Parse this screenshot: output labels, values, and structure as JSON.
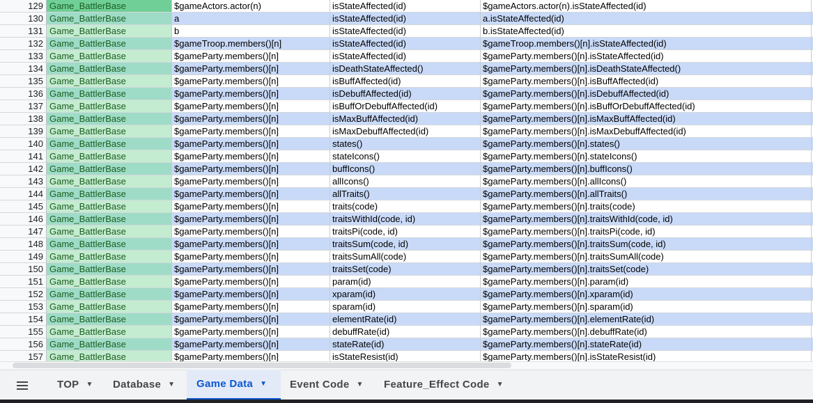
{
  "sheet": {
    "rows": [
      {
        "num": "129",
        "cls": "Game_BattlerBase",
        "obj": "$gameActors.actor(n)",
        "method": "isStateAffected(id)",
        "full": "$gameActors.actor(n).isStateAffected(id)",
        "cls_color": "#6fcf97"
      },
      {
        "num": "130",
        "cls": "Game_BattlerBase",
        "obj": "a",
        "method": "isStateAffected(id)",
        "full": "a.isStateAffected(id)",
        "cls_color": "#9fdcc7"
      },
      {
        "num": "131",
        "cls": "Game_BattlerBase",
        "obj": "b",
        "method": "isStateAffected(id)",
        "full": "b.isStateAffected(id)",
        "cls_color": "#c4ecd0"
      },
      {
        "num": "132",
        "cls": "Game_BattlerBase",
        "obj": "$gameTroop.members()[n]",
        "method": "isStateAffected(id)",
        "full": "$gameTroop.members()[n].isStateAffected(id)",
        "cls_color": "#9fdcc7"
      },
      {
        "num": "133",
        "cls": "Game_BattlerBase",
        "obj": "$gameParty.members()[n]",
        "method": "isStateAffected(id)",
        "full": "$gameParty.members()[n].isStateAffected(id)",
        "cls_color": "#c4ecd0"
      },
      {
        "num": "134",
        "cls": "Game_BattlerBase",
        "obj": "$gameParty.members()[n]",
        "method": "isDeathStateAffected()",
        "full": "$gameParty.members()[n].isDeathStateAffected()",
        "cls_color": "#9fdcc7"
      },
      {
        "num": "135",
        "cls": "Game_BattlerBase",
        "obj": "$gameParty.members()[n]",
        "method": "isBuffAffected(id)",
        "full": "$gameParty.members()[n].isBuffAffected(id)",
        "cls_color": "#c4ecd0"
      },
      {
        "num": "136",
        "cls": "Game_BattlerBase",
        "obj": "$gameParty.members()[n]",
        "method": "isDebuffAffected(id)",
        "full": "$gameParty.members()[n].isDebuffAffected(id)",
        "cls_color": "#9fdcc7"
      },
      {
        "num": "137",
        "cls": "Game_BattlerBase",
        "obj": "$gameParty.members()[n]",
        "method": "isBuffOrDebuffAffected(id)",
        "full": "$gameParty.members()[n].isBuffOrDebuffAffected(id)",
        "cls_color": "#c4ecd0"
      },
      {
        "num": "138",
        "cls": "Game_BattlerBase",
        "obj": "$gameParty.members()[n]",
        "method": "isMaxBuffAffected(id)",
        "full": "$gameParty.members()[n].isMaxBuffAffected(id)",
        "cls_color": "#9fdcc7"
      },
      {
        "num": "139",
        "cls": "Game_BattlerBase",
        "obj": "$gameParty.members()[n]",
        "method": "isMaxDebuffAffected(id)",
        "full": "$gameParty.members()[n].isMaxDebuffAffected(id)",
        "cls_color": "#c4ecd0"
      },
      {
        "num": "140",
        "cls": "Game_BattlerBase",
        "obj": "$gameParty.members()[n]",
        "method": "states()",
        "full": "$gameParty.members()[n].states()",
        "cls_color": "#9fdcc7"
      },
      {
        "num": "141",
        "cls": "Game_BattlerBase",
        "obj": "$gameParty.members()[n]",
        "method": "stateIcons()",
        "full": "$gameParty.members()[n].stateIcons()",
        "cls_color": "#c4ecd0"
      },
      {
        "num": "142",
        "cls": "Game_BattlerBase",
        "obj": "$gameParty.members()[n]",
        "method": "buffIcons()",
        "full": "$gameParty.members()[n].buffIcons()",
        "cls_color": "#9fdcc7"
      },
      {
        "num": "143",
        "cls": "Game_BattlerBase",
        "obj": "$gameParty.members()[n]",
        "method": "allIcons()",
        "full": "$gameParty.members()[n].allIcons()",
        "cls_color": "#c4ecd0"
      },
      {
        "num": "144",
        "cls": "Game_BattlerBase",
        "obj": "$gameParty.members()[n]",
        "method": "allTraits()",
        "full": "$gameParty.members()[n].allTraits()",
        "cls_color": "#9fdcc7"
      },
      {
        "num": "145",
        "cls": "Game_BattlerBase",
        "obj": "$gameParty.members()[n]",
        "method": "traits(code)",
        "full": "$gameParty.members()[n].traits(code)",
        "cls_color": "#c4ecd0"
      },
      {
        "num": "146",
        "cls": "Game_BattlerBase",
        "obj": "$gameParty.members()[n]",
        "method": "traitsWithId(code, id)",
        "full": "$gameParty.members()[n].traitsWithId(code, id)",
        "cls_color": "#9fdcc7"
      },
      {
        "num": "147",
        "cls": "Game_BattlerBase",
        "obj": "$gameParty.members()[n]",
        "method": "traitsPi(code, id)",
        "full": "$gameParty.members()[n].traitsPi(code, id)",
        "cls_color": "#c4ecd0"
      },
      {
        "num": "148",
        "cls": "Game_BattlerBase",
        "obj": "$gameParty.members()[n]",
        "method": "traitsSum(code, id)",
        "full": "$gameParty.members()[n].traitsSum(code, id)",
        "cls_color": "#9fdcc7"
      },
      {
        "num": "149",
        "cls": "Game_BattlerBase",
        "obj": "$gameParty.members()[n]",
        "method": "traitsSumAll(code)",
        "full": "$gameParty.members()[n].traitsSumAll(code)",
        "cls_color": "#c4ecd0"
      },
      {
        "num": "150",
        "cls": "Game_BattlerBase",
        "obj": "$gameParty.members()[n]",
        "method": "traitsSet(code)",
        "full": "$gameParty.members()[n].traitsSet(code)",
        "cls_color": "#9fdcc7"
      },
      {
        "num": "151",
        "cls": "Game_BattlerBase",
        "obj": "$gameParty.members()[n]",
        "method": "param(id)",
        "full": "$gameParty.members()[n].param(id)",
        "cls_color": "#c4ecd0"
      },
      {
        "num": "152",
        "cls": "Game_BattlerBase",
        "obj": "$gameParty.members()[n]",
        "method": "xparam(id)",
        "full": "$gameParty.members()[n].xparam(id)",
        "cls_color": "#9fdcc7"
      },
      {
        "num": "153",
        "cls": "Game_BattlerBase",
        "obj": "$gameParty.members()[n]",
        "method": "sparam(id)",
        "full": "$gameParty.members()[n].sparam(id)",
        "cls_color": "#c4ecd0"
      },
      {
        "num": "154",
        "cls": "Game_BattlerBase",
        "obj": "$gameParty.members()[n]",
        "method": "elementRate(id)",
        "full": "$gameParty.members()[n].elementRate(id)",
        "cls_color": "#9fdcc7"
      },
      {
        "num": "155",
        "cls": "Game_BattlerBase",
        "obj": "$gameParty.members()[n]",
        "method": "debuffRate(id)",
        "full": "$gameParty.members()[n].debuffRate(id)",
        "cls_color": "#c4ecd0"
      },
      {
        "num": "156",
        "cls": "Game_BattlerBase",
        "obj": "$gameParty.members()[n]",
        "method": "stateRate(id)",
        "full": "$gameParty.members()[n].stateRate(id)",
        "cls_color": "#9fdcc7"
      },
      {
        "num": "157",
        "cls": "Game_BattlerBase",
        "obj": "$gameParty.members()[n]",
        "method": "isStateResist(id)",
        "full": "$gameParty.members()[n].isStateResist(id)",
        "cls_color": "#c4ecd0"
      }
    ]
  },
  "tabs": {
    "menu_icon": "hamburger-menu-icon",
    "items": [
      {
        "label": "TOP",
        "active": false
      },
      {
        "label": "Database",
        "active": false
      },
      {
        "label": "Game Data",
        "active": true
      },
      {
        "label": "Event Code",
        "active": false
      },
      {
        "label": "Feature_Effect Code",
        "active": false
      }
    ],
    "caret_glyph": "▼",
    "active_color": "#0b57d0"
  },
  "colors": {
    "alt_row_blue": "#c9daf8",
    "class_text_green": "#1b5e20"
  }
}
